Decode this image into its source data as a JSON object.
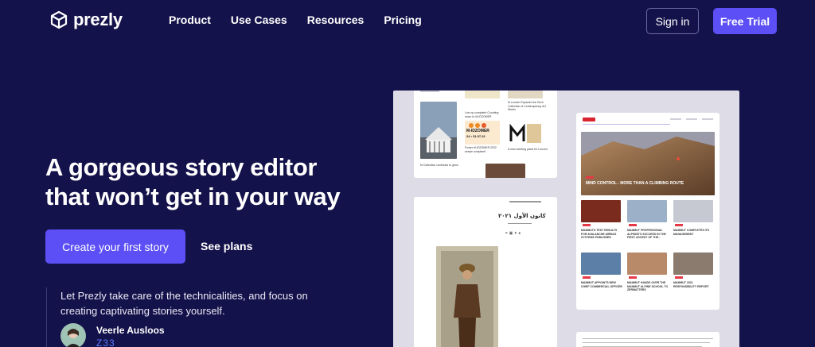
{
  "brand": {
    "name": "prezly"
  },
  "nav": {
    "links": [
      "Product",
      "Use Cases",
      "Resources",
      "Pricing"
    ],
    "signin": "Sign in",
    "trial": "Free Trial"
  },
  "hero": {
    "line1": "A gorgeous story editor",
    "line2": "that won’t get in your way",
    "cta": "Create your first story",
    "secondary": "See plans"
  },
  "testimonial": {
    "quote": "Let Prezly take care of the technicalities, and focus on creating captivating stories yourself.",
    "author": "Veerle Ausloos",
    "company": "Z33"
  },
  "showcase": {
    "newsroom_items": [
      "Live op complete! Counting down to M-IDZOMER",
      "M Leuven Expands the Gera Collection of Contemporary Art Works",
      "A new meeting place for Leuven",
      "Foster M-IDZOMER 2022 sessie compleet!",
      "M Collection continues to grow"
    ],
    "midzomer": "M-IDZOMER",
    "midzomer_dates": "24 • 31.07.22",
    "mammut_hero": "MIND CONTROL - MORE THAN A CLIMBING ROUTE",
    "mammut_items": [
      "MAMMUTS TEST RESULTS FOR AVALANCHE AIRBAG SYSTEMS PUBLISHED",
      "MAMMUT PROFESSIONAL ALPINISTS SUCCEED IN THE FIRST ASCENT OF THE...",
      "MAMMUT COMPLETES ITS MANAGEMENT",
      "MAMMUT APPOINTS NEW CHIEF COMMERCIAL OFFICER",
      "MAMMUT HANDS OVER THE MAMMUT ALPINE SCHOOL TO ZERMATTERS",
      "MAMMUT 2021 RESPONSIBILITY REPORT"
    ],
    "arabic_title": "كانون الأول ٢٠٢١"
  },
  "colors": {
    "background": "#14124a",
    "accent": "#5b4ff5",
    "link": "#5d7bff"
  }
}
